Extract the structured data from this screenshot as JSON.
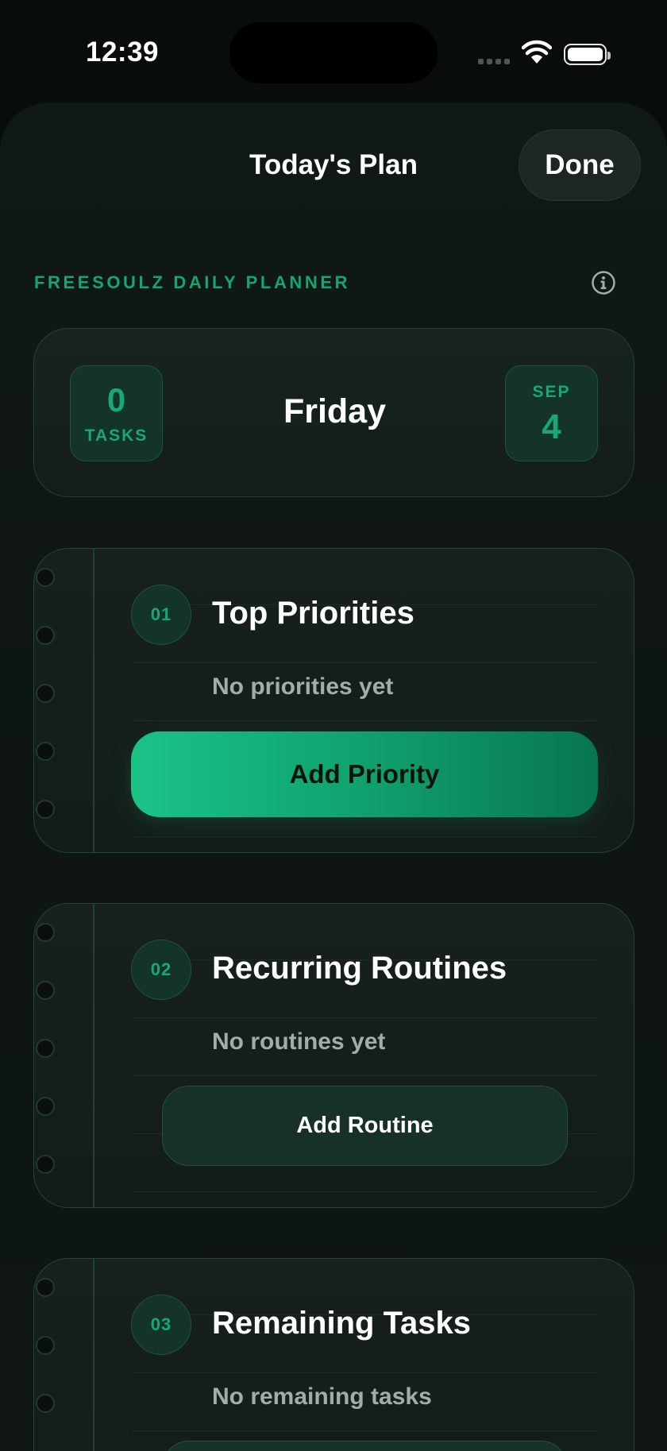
{
  "status_bar": {
    "time": "12:39"
  },
  "header": {
    "title": "Today's Plan",
    "done_label": "Done"
  },
  "planner": {
    "kicker": "FREESOULZ DAILY PLANNER"
  },
  "date_card": {
    "task_count": "0",
    "task_label": "TASKS",
    "day": "Friday",
    "month": "SEP",
    "date": "4"
  },
  "sections": [
    {
      "number": "01",
      "title": "Top Priorities",
      "empty": "No priorities yet",
      "button": "Add Priority"
    },
    {
      "number": "02",
      "title": "Recurring Routines",
      "empty": "No routines yet",
      "button": "Add Routine"
    },
    {
      "number": "03",
      "title": "Remaining Tasks",
      "empty": "No remaining tasks"
    }
  ],
  "colors": {
    "accent": "#17a876",
    "background": "#080c0b",
    "card": "#17201d",
    "button_gradient_start": "#1bc387"
  }
}
